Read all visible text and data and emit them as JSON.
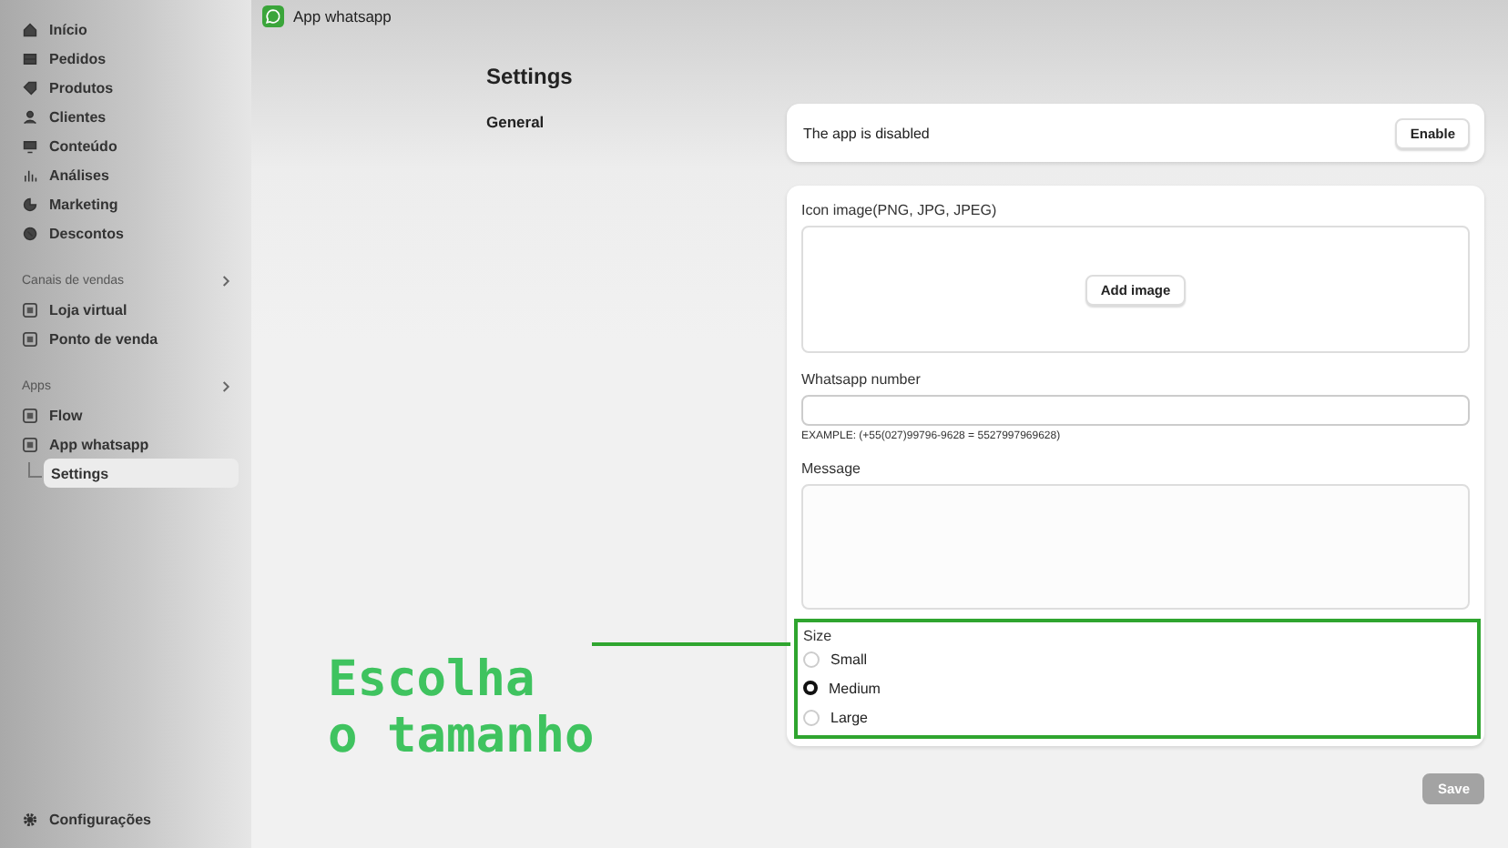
{
  "sidebar": {
    "items": [
      {
        "label": "Início",
        "selected": false
      },
      {
        "label": "Pedidos",
        "selected": false
      },
      {
        "label": "Produtos",
        "selected": false
      },
      {
        "label": "Clientes",
        "selected": false
      },
      {
        "label": "Conteúdo",
        "selected": false
      },
      {
        "label": "Análises",
        "selected": false
      },
      {
        "label": "Marketing",
        "selected": false
      },
      {
        "label": "Descontos",
        "selected": false
      }
    ],
    "sections": [
      {
        "title": "Canais de vendas",
        "items": [
          {
            "label": "Loja virtual",
            "selected": false
          },
          {
            "label": "Ponto de venda",
            "selected": false
          }
        ]
      },
      {
        "title": "Apps",
        "items": [
          {
            "label": "Flow",
            "selected": false
          },
          {
            "label": "App whatsapp",
            "selected": false,
            "children": [
              {
                "label": "Settings",
                "selected": true
              }
            ]
          }
        ]
      }
    ],
    "footer": {
      "label": "Configurações"
    }
  },
  "topbar": {
    "title": "App whatsapp"
  },
  "page": {
    "title": "Settings",
    "section": "General"
  },
  "status_card": {
    "text": "The app is disabled",
    "button": "Enable"
  },
  "form": {
    "icon_label": "Icon image(PNG, JPG, JPEG)",
    "add_button": "Add image",
    "number_label": "Whatsapp number",
    "number_help": "EXAMPLE: (+55(027)99796-9628 = 5527997969628)",
    "message_label": "Message",
    "size": {
      "label": "Size",
      "options": [
        {
          "label": "Small",
          "selected": false
        },
        {
          "label": "Medium",
          "selected": true
        },
        {
          "label": "Large",
          "selected": false
        }
      ]
    }
  },
  "save_button": {
    "label": "Save",
    "disabled": true
  },
  "annotation": {
    "lines": [
      "Escolha",
      "o tamanho"
    ]
  }
}
